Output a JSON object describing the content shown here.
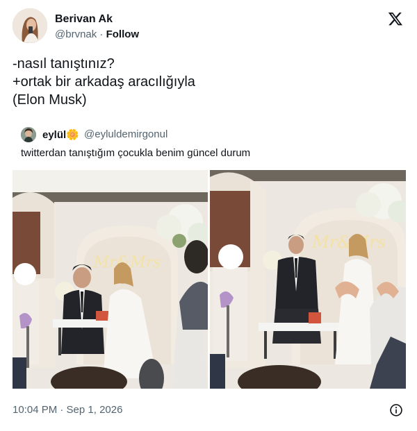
{
  "author": {
    "name": "Berivan Ak",
    "handle": "@brvnak",
    "separator": " · ",
    "follow_label": "Follow"
  },
  "tweet": {
    "lines": [
      "-nasıl tanıştınız?",
      "+ortak bir arkadaş aracılığıyla",
      "(Elon Musk)"
    ]
  },
  "quoted": {
    "name": "eylül",
    "name_emoji": "🌼",
    "handle": "@eyluldemirgonul",
    "text": "twitterdan tanıştığım çocukla benim güncel durum",
    "photos": [
      {
        "sign_text": "Mr&Mrs"
      },
      {
        "sign_text": "Mr&Mrs"
      }
    ]
  },
  "footer": {
    "timestamp": "10:04 PM · Sep 1, 2026"
  },
  "icons": {
    "x_logo": "x-logo-icon",
    "info": "info-icon"
  },
  "colors": {
    "text": "#0f1419",
    "secondary": "#536471",
    "neon_sign": "#f3e2a6"
  }
}
